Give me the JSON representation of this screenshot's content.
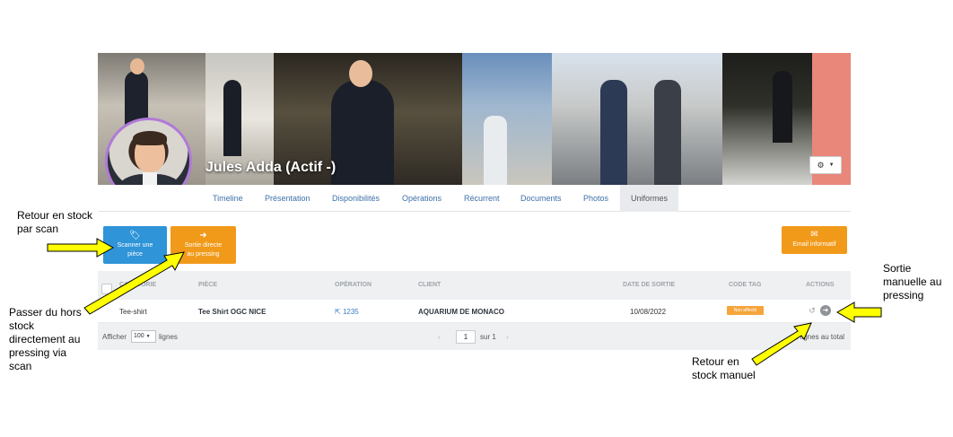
{
  "profile": {
    "name": "Jules Adda (Actif -)"
  },
  "tabs": [
    "Timeline",
    "Présentation",
    "Disponibilités",
    "Opérations",
    "Récurrent",
    "Documents",
    "Photos",
    "Uniformes"
  ],
  "active_tab": "Uniformes",
  "toolbar": {
    "scan_label_1": "Scanner une",
    "scan_label_2": "pièce",
    "direct_label_1": "Sortie directe",
    "direct_label_2": "au pressing",
    "email_label": "Email informatif"
  },
  "table": {
    "headers": [
      "CATÉGORIE",
      "PIÈCE",
      "OPÉRATION",
      "CLIENT",
      "DATE DE SORTIE",
      "CODE TAG",
      "ACTIONS"
    ],
    "row": {
      "category": "Tee-shirt",
      "piece": "Tee Shirt OGC NICE",
      "operation": "1235",
      "client": "AQUARIUM DE MONACO",
      "date": "10/08/2022",
      "tag": "Non affecté"
    },
    "footer": {
      "show_label": "Afficher",
      "page_size": "100",
      "rows_label": "lignes",
      "page": "1",
      "of_label": "sur 1",
      "total": "1 lignes au total"
    }
  },
  "annotations": {
    "scan_return": "Retour en stock par scan",
    "direct_pressing": "Passer du hors stock directement au pressing via scan",
    "manual_exit": "Sortie manuelle au pressing",
    "manual_return": "Retour en stock manuel"
  },
  "colors": {
    "accent_blue": "#2f94d8",
    "accent_orange": "#f19a1a",
    "avatar_ring": "#b07ad8",
    "arrow_fill": "#ffff00",
    "cover_end": "#e8877a"
  },
  "icons": {
    "scan": "tag-icon",
    "direct": "arrow-circle-right-icon",
    "email": "envelope-icon",
    "settings": "gears-icon",
    "external_link": "external-link-icon",
    "return": "undo-icon",
    "exit": "arrow-circle-right-icon"
  }
}
